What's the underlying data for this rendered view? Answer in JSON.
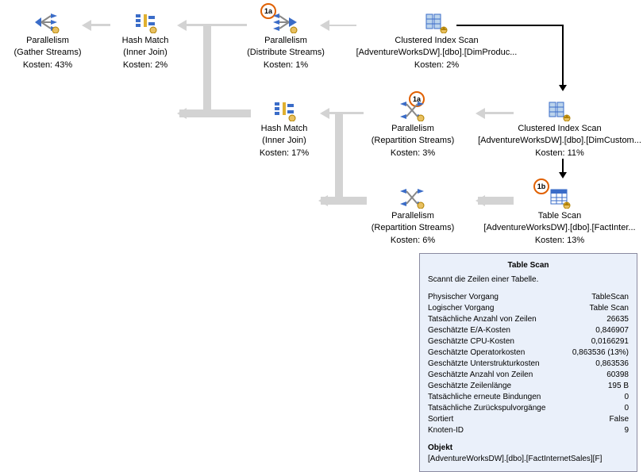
{
  "nodes": {
    "n1": {
      "title": "Parallelism",
      "subtitle": "(Gather Streams)",
      "cost": "Kosten: 43%"
    },
    "n2": {
      "title": "Hash Match",
      "subtitle": "(Inner Join)",
      "cost": "Kosten: 2%"
    },
    "n3": {
      "title": "Parallelism",
      "subtitle": "(Distribute Streams)",
      "cost": "Kosten: 1%"
    },
    "n4": {
      "title": "Clustered Index Scan",
      "subtitle": "[AdventureWorksDW].[dbo].[DimProduc...",
      "cost": "Kosten: 2%"
    },
    "n5": {
      "title": "Hash Match",
      "subtitle": "(Inner Join)",
      "cost": "Kosten: 17%"
    },
    "n6": {
      "title": "Parallelism",
      "subtitle": "(Repartition Streams)",
      "cost": "Kosten: 3%"
    },
    "n7": {
      "title": "Clustered Index Scan",
      "subtitle": "[AdventureWorksDW].[dbo].[DimCustom...",
      "cost": "Kosten: 11%"
    },
    "n8": {
      "title": "Parallelism",
      "subtitle": "(Repartition Streams)",
      "cost": "Kosten: 6%"
    },
    "n9": {
      "title": "Table Scan",
      "subtitle": "[AdventureWorksDW].[dbo].[FactInter...",
      "cost": "Kosten: 13%"
    }
  },
  "badges": {
    "b1": "1a",
    "b2": "1a",
    "b3": "1b"
  },
  "tooltip": {
    "title": "Table Scan",
    "desc": "Scannt die Zeilen einer Tabelle.",
    "rows": [
      {
        "k": "Physischer Vorgang",
        "v": "TableScan"
      },
      {
        "k": "Logischer Vorgang",
        "v": "Table Scan"
      },
      {
        "k": "Tatsächliche Anzahl von Zeilen",
        "v": "26635"
      },
      {
        "k": "Geschätzte E/A-Kosten",
        "v": "0,846907"
      },
      {
        "k": "Geschätzte CPU-Kosten",
        "v": "0,0166291"
      },
      {
        "k": "Geschätzte Operatorkosten",
        "v": "0,863536 (13%)"
      },
      {
        "k": "Geschätzte Unterstrukturkosten",
        "v": "0,863536"
      },
      {
        "k": "Geschätzte Anzahl von Zeilen",
        "v": "60398"
      },
      {
        "k": "Geschätzte Zeilenlänge",
        "v": "195 B"
      },
      {
        "k": "Tatsächliche erneute Bindungen",
        "v": "0"
      },
      {
        "k": "Tatsächliche Zurückspulvorgänge",
        "v": "0"
      },
      {
        "k": "Sortiert",
        "v": "False"
      },
      {
        "k": "Knoten-ID",
        "v": "9"
      }
    ],
    "object_label": "Objekt",
    "object_value": "[AdventureWorksDW].[dbo].[FactInternetSales][F]"
  }
}
